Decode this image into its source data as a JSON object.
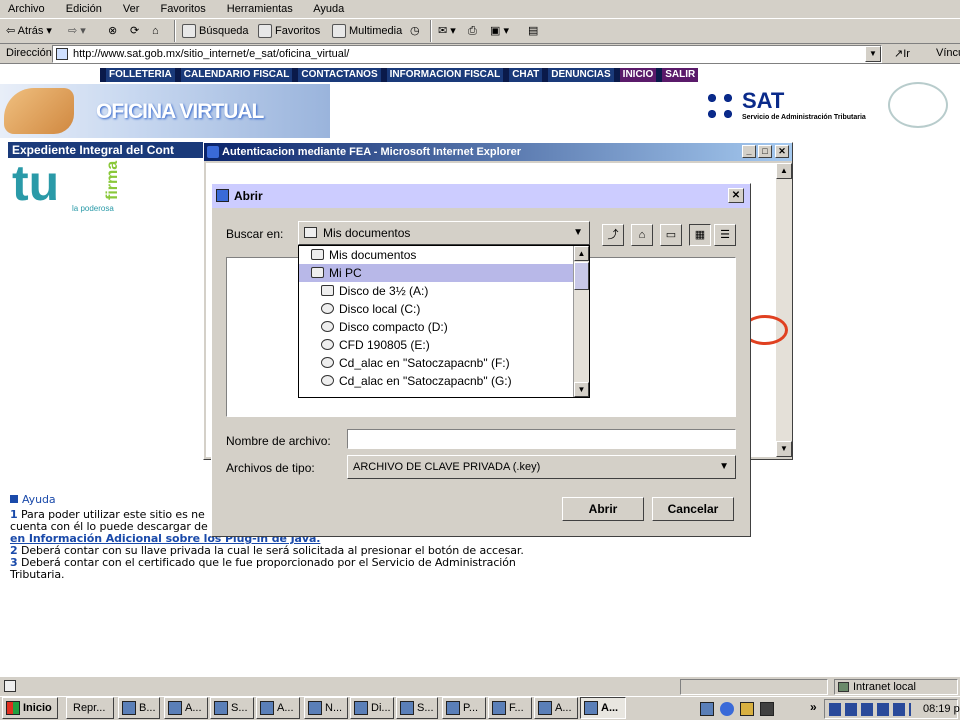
{
  "menu": [
    "Archivo",
    "Edición",
    "Ver",
    "Favoritos",
    "Herramientas",
    "Ayuda"
  ],
  "toolbar": {
    "back": "Atrás",
    "search": "Búsqueda",
    "favorites": "Favoritos",
    "multimedia": "Multimedia"
  },
  "address": {
    "label": "Dirección",
    "url": "http://www.sat.gob.mx/sitio_internet/e_sat/oficina_virtual/",
    "go": "Ir",
    "links": "Vínculos"
  },
  "site": {
    "nav": [
      "FOLLETERIA",
      "CALENDARIO FISCAL",
      "CONTACTANOS",
      "INFORMACION FISCAL",
      "CHAT",
      "DENUNCIAS",
      "INICIO",
      "SALIR"
    ],
    "banner_title": "OFICINA VIRTUAL",
    "sat_logo": "SAT",
    "sat_sub": "Servicio de Administración Tributaria",
    "expediente": "Expediente Integral del Cont",
    "tu": "tu",
    "firma": "firma",
    "la_poderosa": "la poderosa",
    "help_title": "Ayuda",
    "help_1_num": "1",
    "help_1a": "Para poder utilizar este sitio es ne",
    "help_1b": "cuenta con él lo puede descargar de",
    "help_1_link": "en Información Adicional sobre los Plug-in de Java.",
    "help_2_num": "2",
    "help_2": "Deberá contar con su llave privada la cual le será solicitada al presionar el botón de accesar.",
    "help_3_num": "3",
    "help_3a": "Deberá contar con el certificado que le fue proporcionado por el Servicio de Administración",
    "help_3b": "Tributaria."
  },
  "ie_window": {
    "title": "Autenticacion mediante FEA - Microsoft Internet Explorer"
  },
  "dialog": {
    "title": "Abrir",
    "look_in_label": "Buscar en:",
    "look_in_value": "Mis documentos",
    "dropdown_items": [
      "Mis documentos",
      "Mi PC",
      "Disco de 3½ (A:)",
      "Disco local (C:)",
      "Disco compacto (D:)",
      "CFD 190805 (E:)",
      "Cd_alac en \"Satoczapacnb\" (F:)",
      "Cd_alac en \"Satoczapacnb\" (G:)"
    ],
    "filename_label": "Nombre de archivo:",
    "filename_value": "",
    "filetype_label": "Archivos de tipo:",
    "filetype_value": "ARCHIVO DE CLAVE PRIVADA (.key)",
    "open_button": "Abrir",
    "cancel_button": "Cancelar"
  },
  "status": {
    "zone": "Intranet local"
  },
  "taskbar": {
    "start": "Inicio",
    "tasks": [
      "Repr...",
      "B...",
      "A...",
      "S...",
      "A...",
      "N...",
      "Di...",
      "S...",
      "P...",
      "F...",
      "A...",
      "A..."
    ],
    "clock": "08:19 p"
  }
}
